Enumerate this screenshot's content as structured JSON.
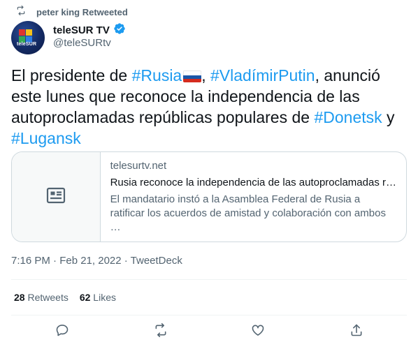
{
  "retweet_header": {
    "label": "peter king Retweeted"
  },
  "author": {
    "display_name": "teleSUR TV",
    "handle": "@teleSURtv",
    "avatar_text": "teleSUR"
  },
  "tweet": {
    "text_prefix": "El presidente de ",
    "hashtag_1": "#Rusia",
    "sep_1": ", ",
    "hashtag_2": "#VladímirPutin",
    "text_mid": ", anunció este lunes que reconoce la independencia de las autoproclamadas repúblicas populares de ",
    "hashtag_3": "#Donetsk",
    "text_and": " y ",
    "hashtag_4": "#Lugansk"
  },
  "link_card": {
    "domain": "telesurtv.net",
    "title": "Rusia reconoce la independencia de las autoproclamadas r…",
    "description": "El mandatario instó a la Asamblea Federal de Rusia a ratificar los acuerdos de amistad y colaboración con ambos …"
  },
  "meta": {
    "timestamp": "7:16 PM · Feb 21, 2022 · TweetDeck"
  },
  "stats": {
    "retweets_count": "28",
    "retweets_label": "Retweets",
    "likes_count": "62",
    "likes_label": "Likes"
  },
  "colors": {
    "link": "#1d9bf0",
    "text": "#0f1419",
    "secondary": "#536471",
    "verified": "#1d9bf0"
  },
  "icons": [
    "retweet-icon",
    "verified-badge-icon",
    "article-icon",
    "reply-icon",
    "like-icon",
    "share-icon",
    "flag-russia-icon"
  ]
}
